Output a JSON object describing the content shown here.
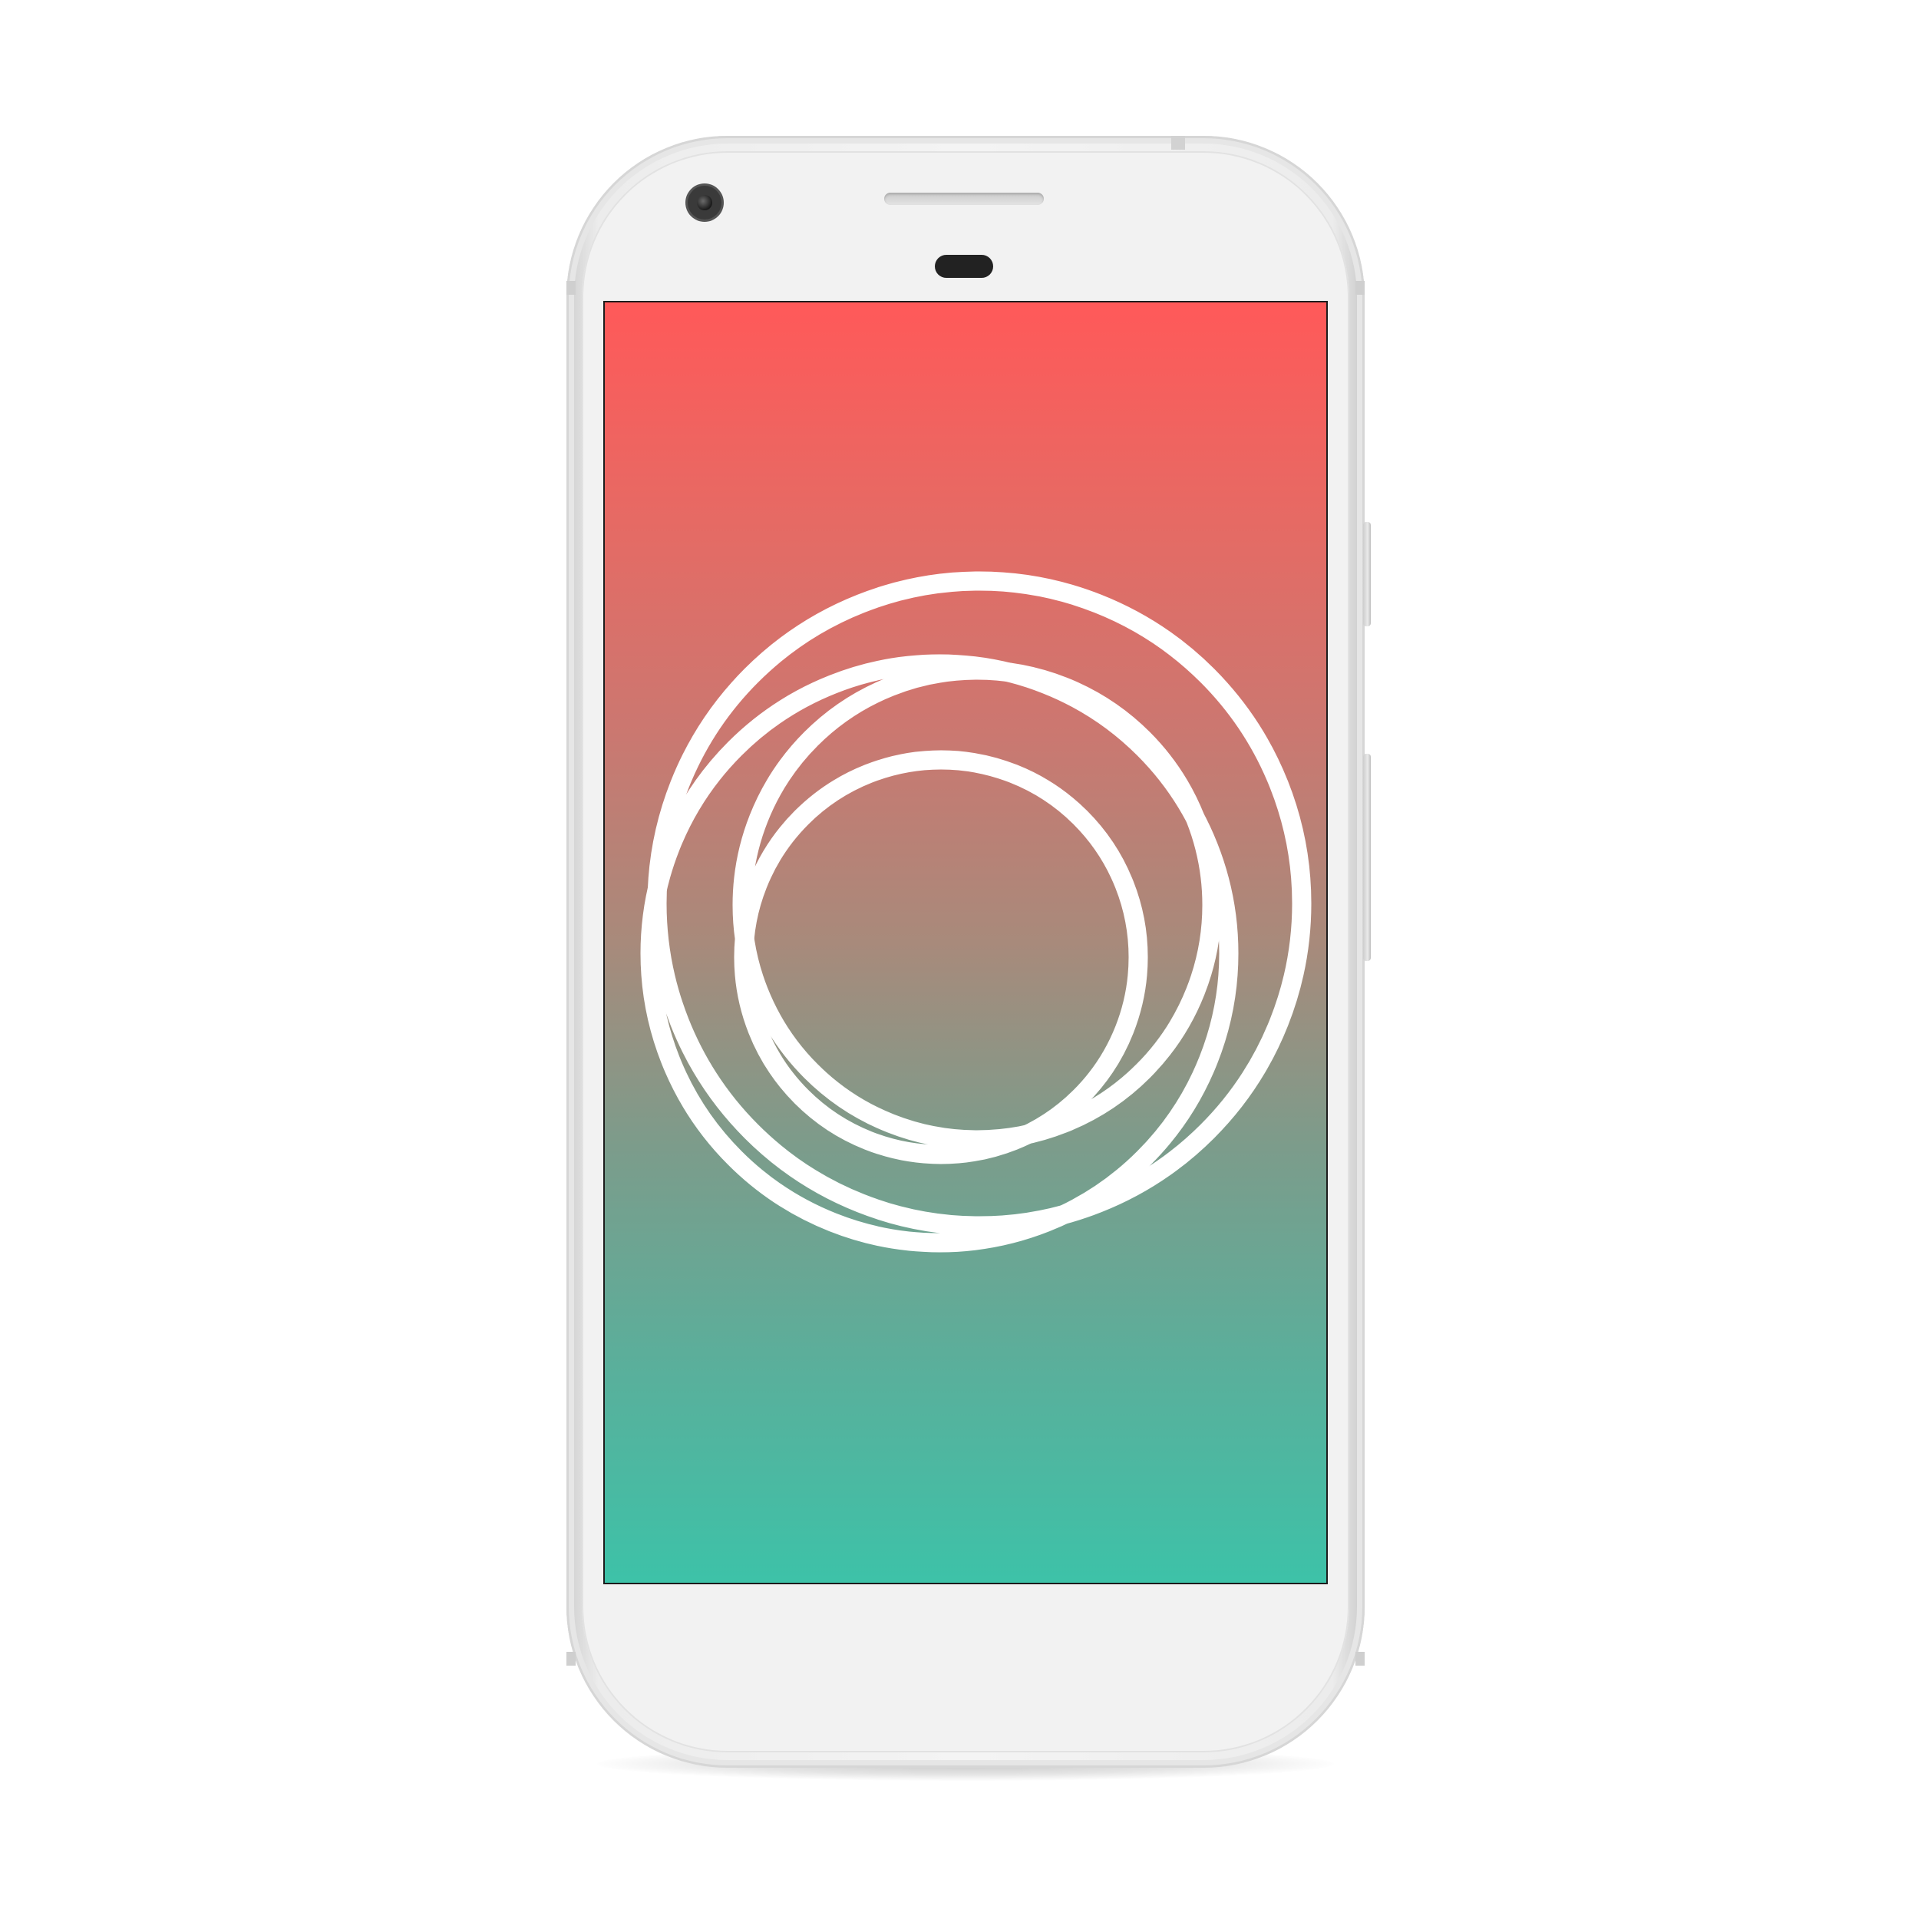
{
  "device": {
    "type": "smartphone",
    "color": "#f2f2f2",
    "icons": {
      "front_camera": "front-camera-icon",
      "earpiece": "earpiece-speaker-icon",
      "sensor": "proximity-sensor-icon"
    }
  },
  "screen": {
    "gradient_top": "#ff5959",
    "gradient_bottom": "#3dc2a8",
    "logo": {
      "icon": "interlocking-rings-logo-icon",
      "color": "#ffffff"
    }
  }
}
